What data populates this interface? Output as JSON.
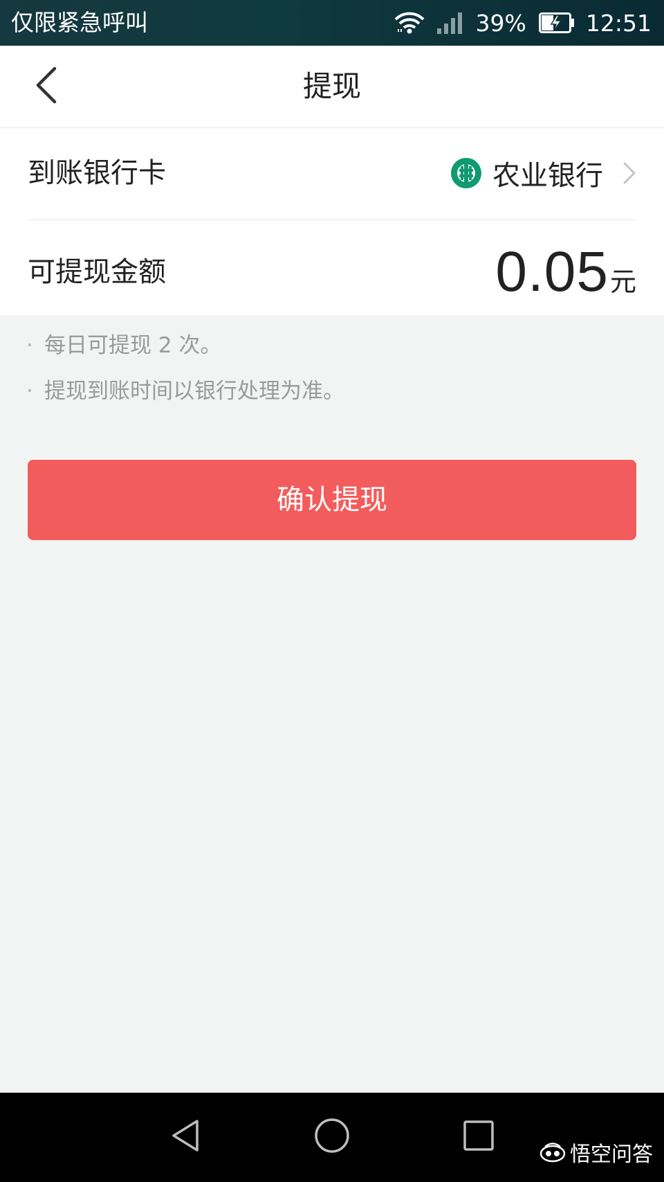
{
  "status_bar": {
    "carrier_text": "仅限紧急呼叫",
    "battery_percent": "39%",
    "time": "12:51",
    "icons": [
      "wifi-icon",
      "signal-icon",
      "battery-charging-icon"
    ]
  },
  "header": {
    "title": "提现",
    "back_icon": "chevron-left-icon"
  },
  "bank_row": {
    "label": "到账银行卡",
    "bank_name": "农业银行",
    "bank_logo": "abc-bank-logo-icon",
    "logo_color": "#0f9a72"
  },
  "amount_row": {
    "label": "可提现金额",
    "value": "0.05",
    "unit": "元"
  },
  "notes": [
    {
      "bullet": "·",
      "text": "每日可提现 2 次。"
    },
    {
      "bullet": "·",
      "text": "提现到账时间以银行处理为准。"
    }
  ],
  "confirm_button": {
    "label": "确认提现",
    "color": "#f35c5c"
  },
  "nav_bar": {
    "icons": [
      "nav-back-icon",
      "nav-home-icon",
      "nav-recent-icon"
    ]
  },
  "watermark": {
    "text": "悟空问答"
  }
}
